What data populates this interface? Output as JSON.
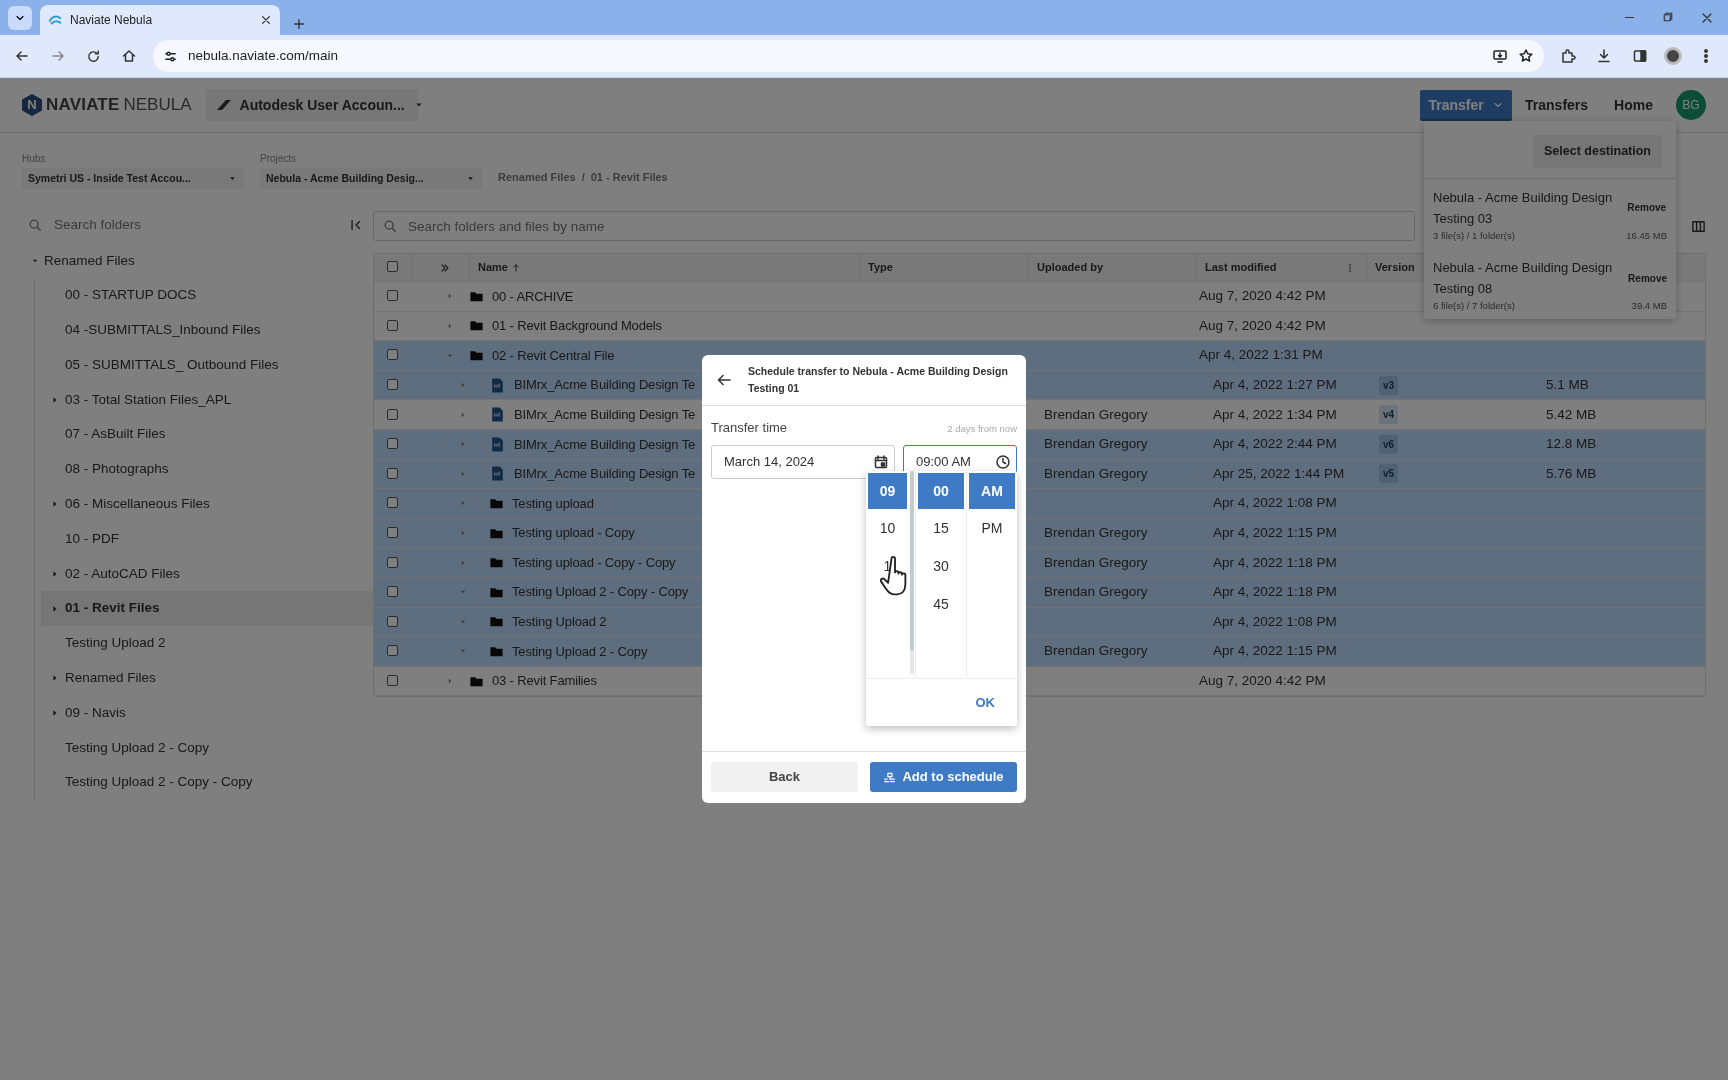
{
  "browser": {
    "tab_title": "Naviate Nebula",
    "url": "nebula.naviate.com/main"
  },
  "header": {
    "logo_mark": "N",
    "logo_bold": "NAVIATE",
    "logo_light": "NEBULA",
    "account": "Autodesk User Accoun...",
    "nav": [
      {
        "label": "Transfer",
        "kind": "dropdown",
        "selected": true
      },
      {
        "label": "Transfers",
        "kind": "link",
        "selected": false
      },
      {
        "label": "Home",
        "kind": "link",
        "selected": false
      }
    ],
    "avatar": "BG"
  },
  "transfer_menu": {
    "button": "Select destination",
    "items": [
      {
        "title": "Nebula - Acme Building Design Testing 03",
        "meta": "3 file(s) / 1 folder(s)",
        "size": "16.45 MB",
        "action": "Remove"
      },
      {
        "title": "Nebula - Acme Building Design Testing 08",
        "meta": "6 file(s) / 7 folder(s)",
        "size": "39.4 MB",
        "action": "Remove"
      }
    ]
  },
  "filters": {
    "hubs": {
      "label": "Hubs",
      "value": "Symetri US - Inside Test Accou..."
    },
    "projects": {
      "label": "Projects",
      "value": "Nebula - Acme Building Desig..."
    },
    "breadcrumb": [
      "Renamed Files",
      "01 - Revit Files"
    ],
    "breadcrumb_separator": "/"
  },
  "sidebar": {
    "search_placeholder": "Search folders",
    "tree": {
      "label": "Renamed Files",
      "expanded": true,
      "children": [
        {
          "label": "00 - STARTUP DOCS",
          "has_children": false,
          "selected": false
        },
        {
          "label": "04 -SUBMITTALS_Inbound Files",
          "has_children": false,
          "selected": false
        },
        {
          "label": "05 - SUBMITTALS_ Outbound Files",
          "has_children": false,
          "selected": false
        },
        {
          "label": "03 - Total Station Files_APL",
          "has_children": true,
          "selected": false
        },
        {
          "label": "07 - AsBuilt Files",
          "has_children": false,
          "selected": false
        },
        {
          "label": "08 - Photographs",
          "has_children": false,
          "selected": false
        },
        {
          "label": "06 - Miscellaneous Files",
          "has_children": true,
          "selected": false
        },
        {
          "label": "10 - PDF",
          "has_children": false,
          "selected": false
        },
        {
          "label": "02 - AutoCAD Files",
          "has_children": true,
          "selected": false
        },
        {
          "label": "01 - Revit Files",
          "has_children": true,
          "selected": true
        },
        {
          "label": "Testing Upload 2",
          "has_children": false,
          "selected": false
        },
        {
          "label": "Renamed Files",
          "has_children": true,
          "selected": false
        },
        {
          "label": "09 - Navis",
          "has_children": true,
          "selected": false
        },
        {
          "label": "Testing Upload 2 - Copy",
          "has_children": false,
          "selected": false
        },
        {
          "label": "Testing Upload 2 - Copy - Copy",
          "has_children": false,
          "selected": false
        }
      ]
    }
  },
  "table": {
    "search_placeholder": "Search folders and files by name",
    "all_checked": false,
    "columns": [
      {
        "label": "Name",
        "sorted": true
      },
      {
        "label": "Type"
      },
      {
        "label": "Uploaded by"
      },
      {
        "label": "Last modified",
        "menu": true
      },
      {
        "label": "Version"
      }
    ],
    "rows": [
      {
        "kind": "folder",
        "name": "00 - ARCHIVE",
        "expanded": false,
        "selected": false,
        "modified": "Aug 7, 2020 4:42 PM"
      },
      {
        "kind": "folder",
        "name": "01 - Revit Background Models",
        "expanded": false,
        "selected": false,
        "modified": "Aug 7, 2020 4:42 PM"
      },
      {
        "kind": "folder",
        "name": "02 - Revit Central File",
        "expanded": true,
        "selected": true,
        "modified": "Apr 4, 2022 1:31 PM",
        "children": [
          {
            "kind": "file",
            "name": "BIMrx_Acme Building Design Te",
            "expanded": false,
            "selected": true,
            "modified": "Apr 4, 2022 1:27 PM",
            "version": "v3",
            "size": "5.1 MB"
          },
          {
            "kind": "file",
            "name": "BIMrx_Acme Building Design Te",
            "expanded": false,
            "selected": false,
            "uploaded_by": "Brendan Gregory",
            "modified": "Apr 4, 2022 1:34 PM",
            "version": "v4",
            "size": "5.42 MB"
          },
          {
            "kind": "file",
            "name": "BIMrx_Acme Building Design Te",
            "expanded": false,
            "selected": true,
            "uploaded_by": "Brendan Gregory",
            "modified": "Apr 4, 2022 2:44 PM",
            "version": "v6",
            "size": "12.8 MB"
          },
          {
            "kind": "file",
            "name": "BIMrx_Acme Building Design Te",
            "expanded": false,
            "selected": true,
            "uploaded_by": "Brendan Gregory",
            "modified": "Apr 25, 2022 1:44 PM",
            "version": "v5",
            "size": "5.76 MB"
          },
          {
            "kind": "folder",
            "name": "Testing upload",
            "expanded": false,
            "selected": true,
            "modified": "Apr 4, 2022 1:08 PM"
          },
          {
            "kind": "folder",
            "name": "Testing upload - Copy",
            "expanded": false,
            "selected": true,
            "uploaded_by": "Brendan Gregory",
            "modified": "Apr 4, 2022 1:15 PM"
          },
          {
            "kind": "folder",
            "name": "Testing upload - Copy - Copy",
            "expanded": false,
            "selected": true,
            "uploaded_by": "Brendan Gregory",
            "modified": "Apr 4, 2022 1:18 PM"
          },
          {
            "kind": "folder",
            "name": "Testing Upload 2 - Copy - Copy",
            "expanded": true,
            "selected": true,
            "uploaded_by": "Brendan Gregory",
            "modified": "Apr 4, 2022 1:18 PM"
          },
          {
            "kind": "folder",
            "name": "Testing Upload 2",
            "expanded": true,
            "selected": true,
            "modified": "Apr 4, 2022 1:08 PM"
          },
          {
            "kind": "folder",
            "name": "Testing Upload 2 - Copy",
            "expanded": true,
            "selected": true,
            "uploaded_by": "Brendan Gregory",
            "modified": "Apr 4, 2022 1:15 PM"
          }
        ]
      },
      {
        "kind": "folder",
        "name": "03 - Revit Families",
        "expanded": false,
        "selected": false,
        "modified": "Aug 7, 2020 4:42 PM"
      }
    ]
  },
  "modal": {
    "title": "Schedule transfer to Nebula - Acme Building Design Testing 01",
    "field_label": "Transfer time",
    "hint": "2 days from now",
    "date": "March 14, 2024",
    "time": "09:00 AM",
    "picker": {
      "hours": [
        {
          "label": "09",
          "selected": true
        },
        {
          "label": "10",
          "selected": false
        },
        {
          "label": "1",
          "selected": false
        }
      ],
      "minutes": [
        {
          "label": "00",
          "selected": true
        },
        {
          "label": "15",
          "selected": false
        },
        {
          "label": "30",
          "selected": false
        },
        {
          "label": "45",
          "selected": false
        }
      ],
      "periods": [
        {
          "label": "AM",
          "selected": true
        },
        {
          "label": "PM",
          "selected": false
        }
      ],
      "ok": "OK"
    },
    "buttons": [
      {
        "label": "Back",
        "kind": "secondary"
      },
      {
        "label": "Add to schedule",
        "kind": "primary"
      }
    ]
  }
}
